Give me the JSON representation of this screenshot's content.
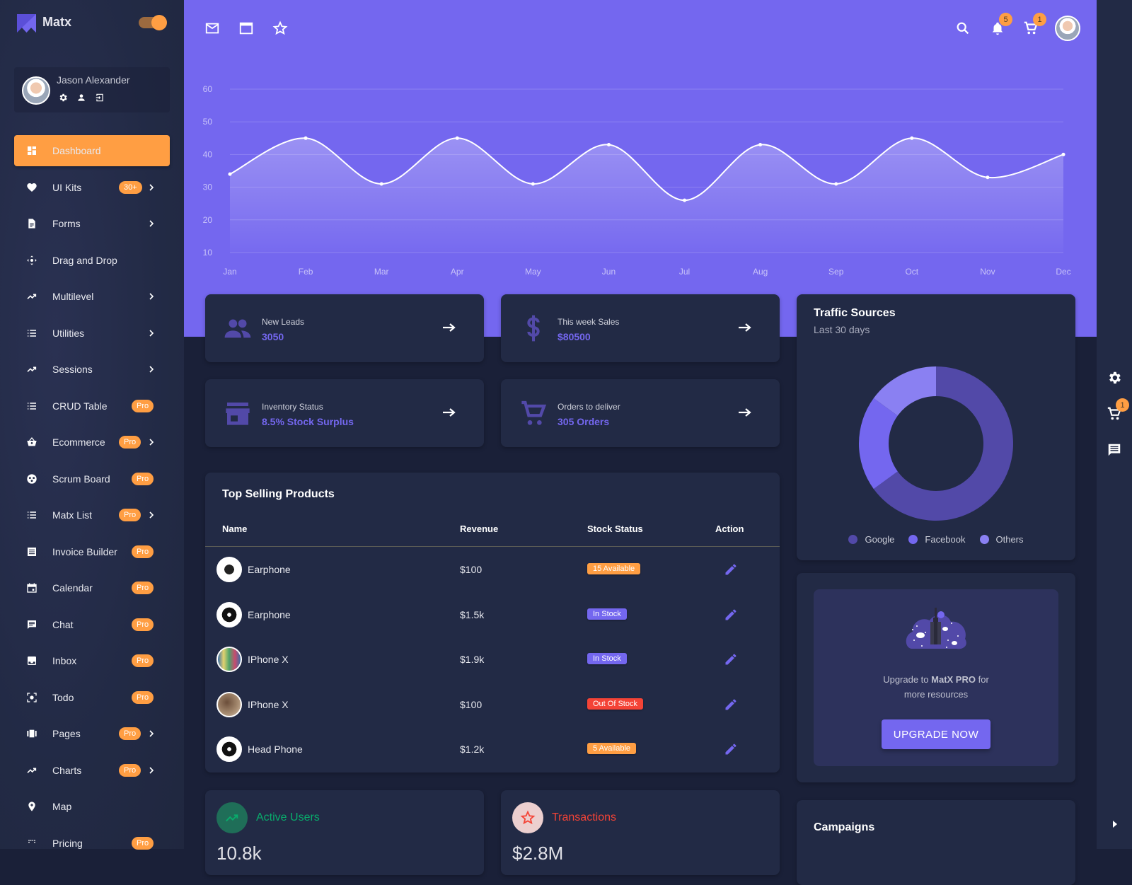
{
  "brand": {
    "name": "Matx",
    "theme_toggle_on": true
  },
  "user": {
    "name": "Jason Alexander",
    "icons": [
      "gear-icon",
      "person-icon",
      "logout-icon"
    ]
  },
  "sidebar": {
    "items": [
      {
        "label": "Dashboard",
        "icon": "dashboard-icon",
        "active": true
      },
      {
        "label": "UI Kits",
        "icon": "heart-icon",
        "badge": "30+",
        "chevron": true
      },
      {
        "label": "Forms",
        "icon": "document-icon",
        "chevron": true
      },
      {
        "label": "Drag and Drop",
        "icon": "move-icon"
      },
      {
        "label": "Multilevel",
        "icon": "trending-icon",
        "chevron": true
      },
      {
        "label": "Utilities",
        "icon": "list-icon",
        "chevron": true
      },
      {
        "label": "Sessions",
        "icon": "trending-icon",
        "chevron": true
      },
      {
        "label": "CRUD Table",
        "icon": "list-icon",
        "badge": "Pro"
      },
      {
        "label": "Ecommerce",
        "icon": "basket-icon",
        "badge": "Pro",
        "chevron": true
      },
      {
        "label": "Scrum Board",
        "icon": "scrum-icon",
        "badge": "Pro"
      },
      {
        "label": "Matx List",
        "icon": "list-icon",
        "badge": "Pro",
        "chevron": true
      },
      {
        "label": "Invoice Builder",
        "icon": "invoice-icon",
        "badge": "Pro"
      },
      {
        "label": "Calendar",
        "icon": "calendar-icon",
        "badge": "Pro"
      },
      {
        "label": "Chat",
        "icon": "chat-icon",
        "badge": "Pro"
      },
      {
        "label": "Inbox",
        "icon": "inbox-icon",
        "badge": "Pro"
      },
      {
        "label": "Todo",
        "icon": "todo-icon",
        "badge": "Pro"
      },
      {
        "label": "Pages",
        "icon": "pages-icon",
        "badge": "Pro",
        "chevron": true
      },
      {
        "label": "Charts",
        "icon": "trending-icon",
        "badge": "Pro",
        "chevron": true
      },
      {
        "label": "Map",
        "icon": "map-pin-icon"
      },
      {
        "label": "Pricing",
        "icon": "pricing-icon",
        "badge": "Pro"
      }
    ]
  },
  "topbar": {
    "left_icons": [
      "mail-icon",
      "window-icon",
      "star-icon"
    ],
    "notifications": "5",
    "cart": "1"
  },
  "chart_data": {
    "type": "area",
    "categories": [
      "Jan",
      "Feb",
      "Mar",
      "Apr",
      "May",
      "Jun",
      "Jul",
      "Aug",
      "Sep",
      "Oct",
      "Nov",
      "Dec"
    ],
    "values": [
      34,
      45,
      31,
      45,
      31,
      43,
      26,
      43,
      31,
      45,
      33,
      40
    ],
    "ylim": [
      10,
      60
    ],
    "yticks": [
      "10",
      "20",
      "30",
      "40",
      "50",
      "60"
    ],
    "grid": true,
    "line_color": "#ffffff"
  },
  "stats": [
    {
      "label": "New Leads",
      "value": "3050",
      "icon": "people-icon"
    },
    {
      "label": "This week Sales",
      "value": "$80500",
      "icon": "dollar-icon"
    },
    {
      "label": "Inventory Status",
      "value": "8.5% Stock Surplus",
      "icon": "store-icon"
    },
    {
      "label": "Orders to deliver",
      "value": "305 Orders",
      "icon": "cart-icon"
    }
  ],
  "products": {
    "title": "Top Selling Products",
    "columns": [
      "Name",
      "Revenue",
      "Stock Status",
      "Action"
    ],
    "rows": [
      {
        "name": "Earphone",
        "revenue": "$100",
        "status": "15 Available",
        "status_color": "#ff9e43"
      },
      {
        "name": "Earphone",
        "revenue": "$1.5k",
        "status": "In Stock",
        "status_color": "#7467ef"
      },
      {
        "name": "IPhone X",
        "revenue": "$1.9k",
        "status": "In Stock",
        "status_color": "#7467ef"
      },
      {
        "name": "IPhone X",
        "revenue": "$100",
        "status": "Out Of Stock",
        "status_color": "#f44336"
      },
      {
        "name": "Head Phone",
        "revenue": "$1.2k",
        "status": "5 Available",
        "status_color": "#ff9e43"
      }
    ]
  },
  "traffic": {
    "title": "Traffic Sources",
    "subtitle": "Last 30 days",
    "chart_data": {
      "type": "pie",
      "series": [
        {
          "name": "Google",
          "value": 65,
          "color": "#5249a8"
        },
        {
          "name": "Facebook",
          "value": 20,
          "color": "#7467ef"
        },
        {
          "name": "Others",
          "value": 15,
          "color": "#8a80f2"
        }
      ]
    }
  },
  "upgrade": {
    "text_pre": "Upgrade to ",
    "text_bold": "MatX PRO",
    "text_post": " for",
    "text_line2": "more resources",
    "button": "UPGRADE NOW"
  },
  "bottom": {
    "active_users": {
      "label": "Active Users",
      "value": "10.8k",
      "color": "#08ad6c"
    },
    "transactions": {
      "label": "Transactions",
      "value": "$2.8M",
      "color": "#f44336"
    },
    "campaigns": {
      "title": "Campaigns"
    }
  },
  "rightbar": {
    "icons": [
      "gear-icon",
      "cart-icon",
      "chat-icon",
      "arrow-right-icon"
    ],
    "cart": "1"
  },
  "colors": {
    "primary": "#7467ef",
    "accent": "#ff9e43",
    "sidebar": "#222a45",
    "background": "#1a2038"
  }
}
